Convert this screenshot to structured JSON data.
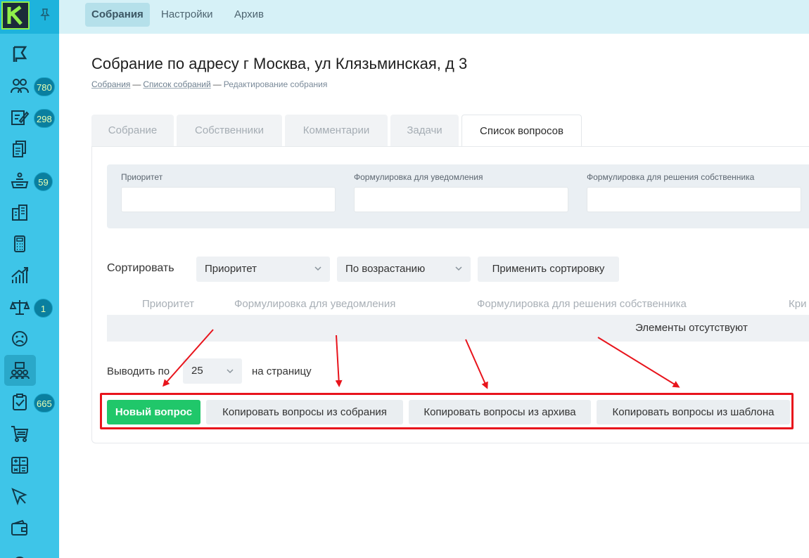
{
  "top_nav": {
    "tabs": [
      {
        "label": "Собрания",
        "active": true
      },
      {
        "label": "Настройки",
        "active": false
      },
      {
        "label": "Архив",
        "active": false
      }
    ]
  },
  "sidebar": {
    "badges": {
      "owners": "780",
      "edit": "298",
      "inbox": "59",
      "law": "1",
      "tasks": "665"
    }
  },
  "header": {
    "title": "Собрание по адресу г Москва, ул Клязьминская, д 3",
    "breadcrumbs": [
      "Собрания",
      "Список собраний",
      "Редактирование собрания"
    ]
  },
  "tabs": [
    "Собрание",
    "Собственники",
    "Комментарии",
    "Задачи",
    "Список вопросов"
  ],
  "filter": {
    "priority_label": "Приоритет",
    "notice_label": "Формулировка для уведомления",
    "decision_label": "Формулировка для решения собственника"
  },
  "sort": {
    "label": "Сортировать",
    "field": "Приоритет",
    "order": "По возрастанию",
    "apply": "Применить сортировку"
  },
  "table": {
    "columns": [
      "Приоритет",
      "Формулировка для уведомления",
      "Формулировка для решения собственника",
      "Кри"
    ],
    "empty": "Элементы отсутствуют"
  },
  "pagination": {
    "prefix": "Выводить по",
    "value": "25",
    "suffix": "на страницу"
  },
  "actions": {
    "new": "Новый вопрос",
    "copy_meeting": "Копировать вопросы из собрания",
    "copy_archive": "Копировать вопросы из архива",
    "copy_template": "Копировать вопросы из шаблона"
  },
  "colors": {
    "sidebar": "#3ec5e8",
    "accent_green": "#20c76a",
    "annotation_red": "#e8141c"
  }
}
